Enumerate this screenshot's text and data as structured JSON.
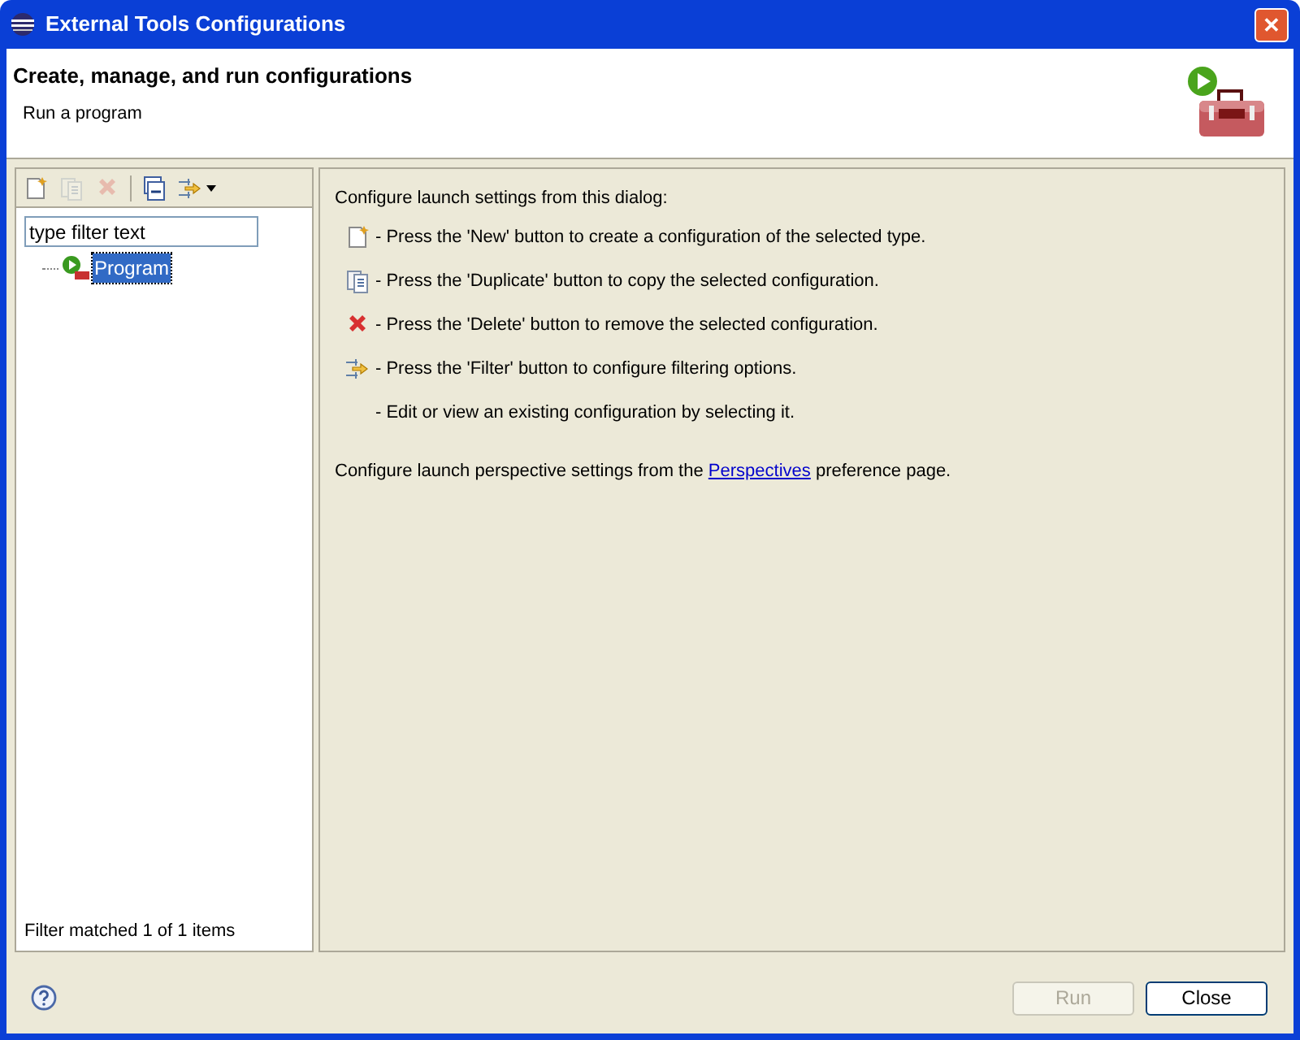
{
  "window": {
    "title": "External Tools Configurations",
    "close": "✕"
  },
  "header": {
    "title": "Create, manage, and run configurations",
    "message": "Run a program"
  },
  "toolbar": [
    {
      "kind": "new",
      "disabled": false
    },
    {
      "kind": "duplicate",
      "disabled": true
    },
    {
      "kind": "delete",
      "disabled": true
    },
    {
      "kind": "collapse",
      "disabled": false
    },
    {
      "kind": "filter",
      "disabled": false
    }
  ],
  "filter": {
    "placeholder": "type filter text"
  },
  "tree": [
    {
      "label": "Program",
      "selected": true
    }
  ],
  "filter_status": "Filter matched 1 of 1 items",
  "intro": "Configure launch settings from this dialog:",
  "instructions": [
    {
      "kind": "new",
      "text": "- Press the 'New' button to create a configuration of the selected type."
    },
    {
      "kind": "duplicate",
      "text": "- Press the 'Duplicate' button to copy the selected configuration."
    },
    {
      "kind": "delete",
      "text": "- Press the 'Delete' button to remove the selected configuration."
    },
    {
      "kind": "filter",
      "text": "- Press the 'Filter' button to configure filtering options."
    },
    {
      "kind": "none",
      "text": "- Edit or view an existing configuration by selecting it."
    }
  ],
  "perspective_note": {
    "before": "Configure launch perspective settings from the ",
    "link": "Perspectives",
    "after": " preference page."
  },
  "buttons": [
    {
      "label": "Run",
      "disabled": true
    },
    {
      "label": "Close",
      "disabled": false
    }
  ]
}
